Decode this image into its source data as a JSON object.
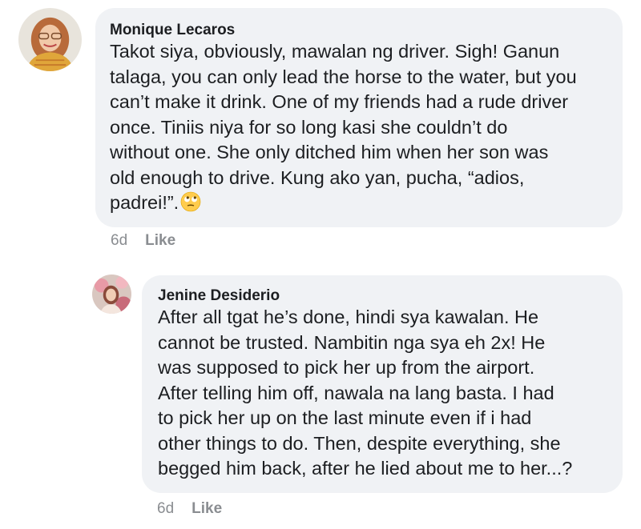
{
  "comments": [
    {
      "author": "Monique Lecaros",
      "text": "Takot siya, obviously, mawalan ng driver. Sigh! Ganun\ntalaga, you can only lead the horse to the water, but you\ncan’t make it drink. One of my friends had a rude driver\nonce. Tiniis niya for so long kasi she couldn’t do\nwithout one. She only ditched him when her son was\nold enough to drive. Kung ako yan, pucha, “adios,\npadrei!”.",
      "emoji": "eye-roll-emoji",
      "time": "6d",
      "like_label": "Like"
    },
    {
      "author": "Jenine Desiderio",
      "text": "After all tgat he’s done, hindi sya kawalan. He\ncannot be trusted. Nambitin nga sya eh 2x! He\nwas supposed to pick her up from the airport.\nAfter telling him off, nawala na lang basta. I had\nto pick her up on the last minute even if i had\nother things to do. Then, despite everything, she\nbegged him back, after he lied about me to her...?",
      "time": "6d",
      "like_label": "Like"
    }
  ],
  "colors": {
    "bubble": "#f0f2f5",
    "text": "#1c1e21",
    "meta": "#8a8d91"
  }
}
